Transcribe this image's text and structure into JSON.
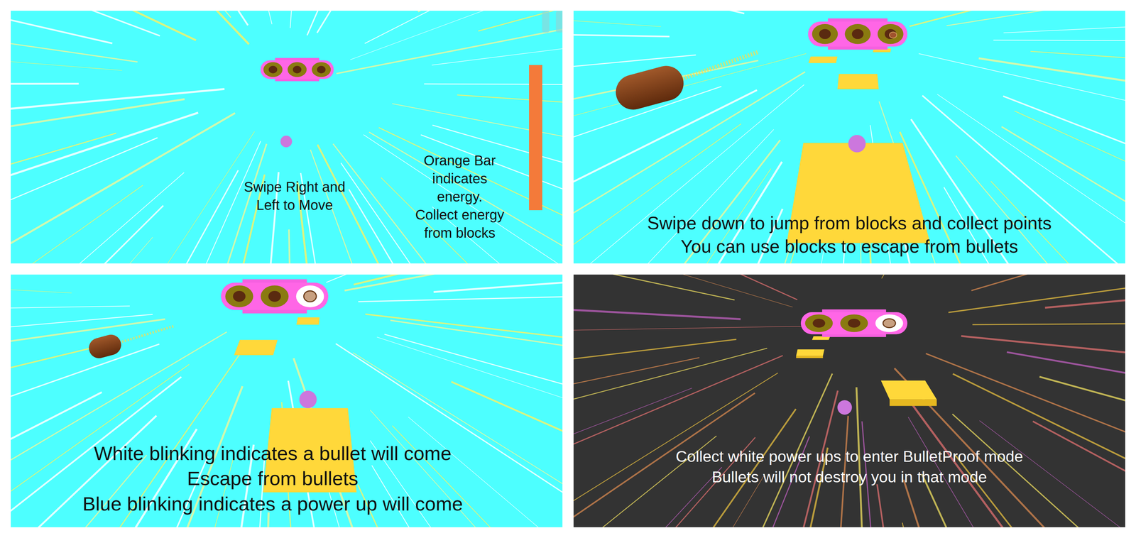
{
  "panels": [
    {
      "kind": "intro",
      "mode": "normal",
      "bullet": false,
      "eyes": [
        {
          "blinking": false,
          "firing": false
        },
        {
          "blinking": false,
          "firing": false
        },
        {
          "blinking": false,
          "firing": false
        }
      ],
      "hint": [
        "Swipe Right and",
        "Left to Move"
      ],
      "energy": {
        "level": 1,
        "note": [
          "Orange Bar",
          "indicates",
          "energy.",
          "Collect energy",
          "from blocks"
        ]
      }
    },
    {
      "kind": "tutorial",
      "mode": "normal",
      "bullet": true,
      "eyes": [
        {
          "blinking": false,
          "firing": false
        },
        {
          "blinking": false,
          "firing": false
        },
        {
          "blinking": false,
          "firing": true
        }
      ],
      "caption": [
        "Swipe down to jump from blocks and collect points",
        "You can use blocks to escape from bullets"
      ]
    },
    {
      "kind": "tutorial",
      "mode": "normal",
      "bullet": true,
      "eyes": [
        {
          "blinking": false,
          "firing": false
        },
        {
          "blinking": false,
          "firing": false
        },
        {
          "blinking": true,
          "firing": false
        }
      ],
      "caption": [
        "White blinking indicates a bullet will come",
        "Escape from bullets",
        "Blue blinking indicates a power up will come"
      ]
    },
    {
      "kind": "tutorial",
      "mode": "bulletproof",
      "bullet": false,
      "eyes": [
        {
          "blinking": false,
          "firing": false
        },
        {
          "blinking": false,
          "firing": false
        },
        {
          "blinking": true,
          "firing": false
        }
      ],
      "caption": [
        "Collect white power ups to enter BulletProof mode",
        "Bullets will not destroy you in that mode"
      ]
    }
  ]
}
